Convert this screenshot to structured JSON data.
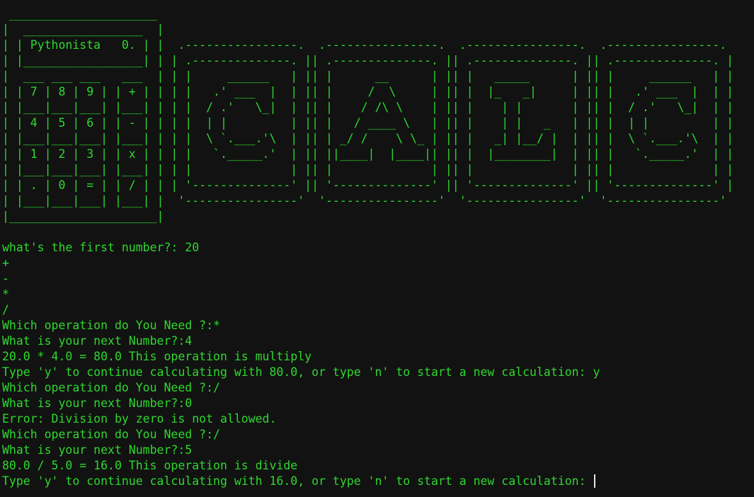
{
  "terminal": {
    "banner_lines": [
      " _____________________",
      "|  _________________  |",
      "| | Pythonista   0. | |  .----------------.  .----------------.  .----------------.  .----------------.",
      "| |_________________| | | .--------------. || .--------------. || .--------------. || .--------------. |",
      "|  ___ ___ ___   ___  | | |     ______   | || |      __      | || |   _____      | || |     ______   | |",
      "| | 7 | 8 | 9 | | + | | | |   .' ___  |  | || |     /  \\     | || |  |_   _|     | || |   .' ___  |  | |",
      "| |___|___|___| |___| | | |  / .'   \\_|  | || |    / /\\ \\    | || |    | |       | || |  / .'   \\_|  | |",
      "| | 4 | 5 | 6 | | - | | | |  | |         | || |   / ____ \\   | || |    | |   _   | || |  | |         | |",
      "| |___|___|___| |___| | | |  \\ `.___.'\\  | || | _/ /    \\ \\_ | || |   _| |__/ |  | || |  \\ `.___.'\\  | |",
      "| | 1 | 2 | 3 | | x | | | |   `._____.'  | || ||____|  |____|| || |  |________|  | || |   `._____.'  | |",
      "| |___|___|___| |___| | | |              | || |              | || |              | || |              | |",
      "| | . | 0 | = | | / | | | '--------------' || '--------------' || '--------------' || '--------------' |",
      "| |___|___|___| |___| |  '----------------'  '----------------'  '----------------'  '----------------'",
      "|_____________________|"
    ],
    "session_lines": [
      "",
      "what's the first number?: 20",
      "+",
      "-",
      "*",
      "/",
      "Which operation do You Need ?:*",
      "What is your next Number?:4",
      "20.0 * 4.0 = 80.0 This operation is multiply",
      "Type 'y' to continue calculating with 80.0, or type 'n' to start a new calculation: y",
      "Which operation do You Need ?:/",
      "What is your next Number?:0",
      "Error: Division by zero is not allowed.",
      "Which operation do You Need ?:/",
      "What is your next Number?:5",
      "80.0 / 5.0 = 16.0 This operation is divide"
    ],
    "prompt_line": "Type 'y' to continue calculating with 16.0, or type 'n' to start a new calculation: ",
    "colors": {
      "background": "#121212",
      "foreground": "#2ed82e",
      "cursor": "#e6e6e6"
    }
  }
}
